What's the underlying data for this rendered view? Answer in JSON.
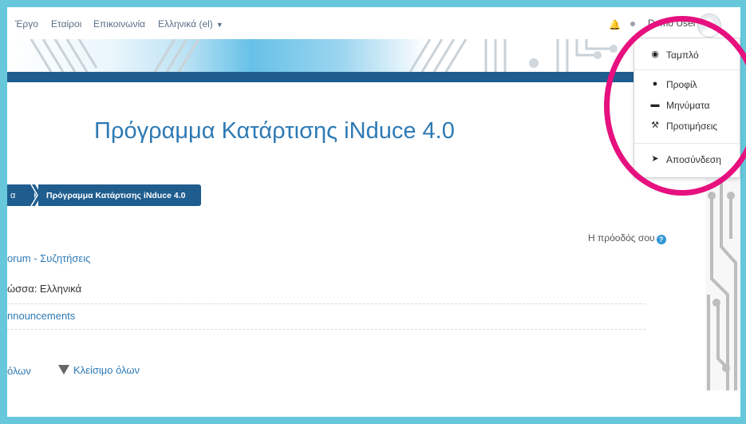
{
  "navbar": {
    "links": [
      "Έργο",
      "Εταίροι",
      "Επικοινωνία"
    ],
    "language": "Ελληνικά (el)",
    "user_name": "Demo User"
  },
  "user_menu": {
    "items": [
      {
        "label": "Ταμπλό",
        "icon": "dashboard-icon"
      },
      {
        "label": "Προφίλ",
        "icon": "user-icon"
      },
      {
        "label": "Μηνύματα",
        "icon": "message-icon"
      },
      {
        "label": "Προτιμήσεις",
        "icon": "wrench-icon"
      },
      {
        "label": "Αποσύνδεση",
        "icon": "logout-icon"
      }
    ]
  },
  "page": {
    "title": "Πρόγραμμα Κατάρτισης iNduce 4.0"
  },
  "breadcrumb": {
    "first_fragment": "α",
    "current": "Πρόγραμμα Κατάρτισης iNduce 4.0"
  },
  "progress": {
    "label": "Η πρόοδός σου",
    "help": "?"
  },
  "course": {
    "forum_link": "orum - Συζητήσεις",
    "language_note": "ώσσα: Ελληνικά",
    "announcements_link": "nnouncements"
  },
  "controls": {
    "expand_all": "όλων",
    "collapse_all": "Κλείσιμο όλων"
  },
  "colors": {
    "frame": "#66c8da",
    "primary_blue": "#1f5d8f",
    "link": "#2e7ab4",
    "highlight": "#e6107f"
  }
}
